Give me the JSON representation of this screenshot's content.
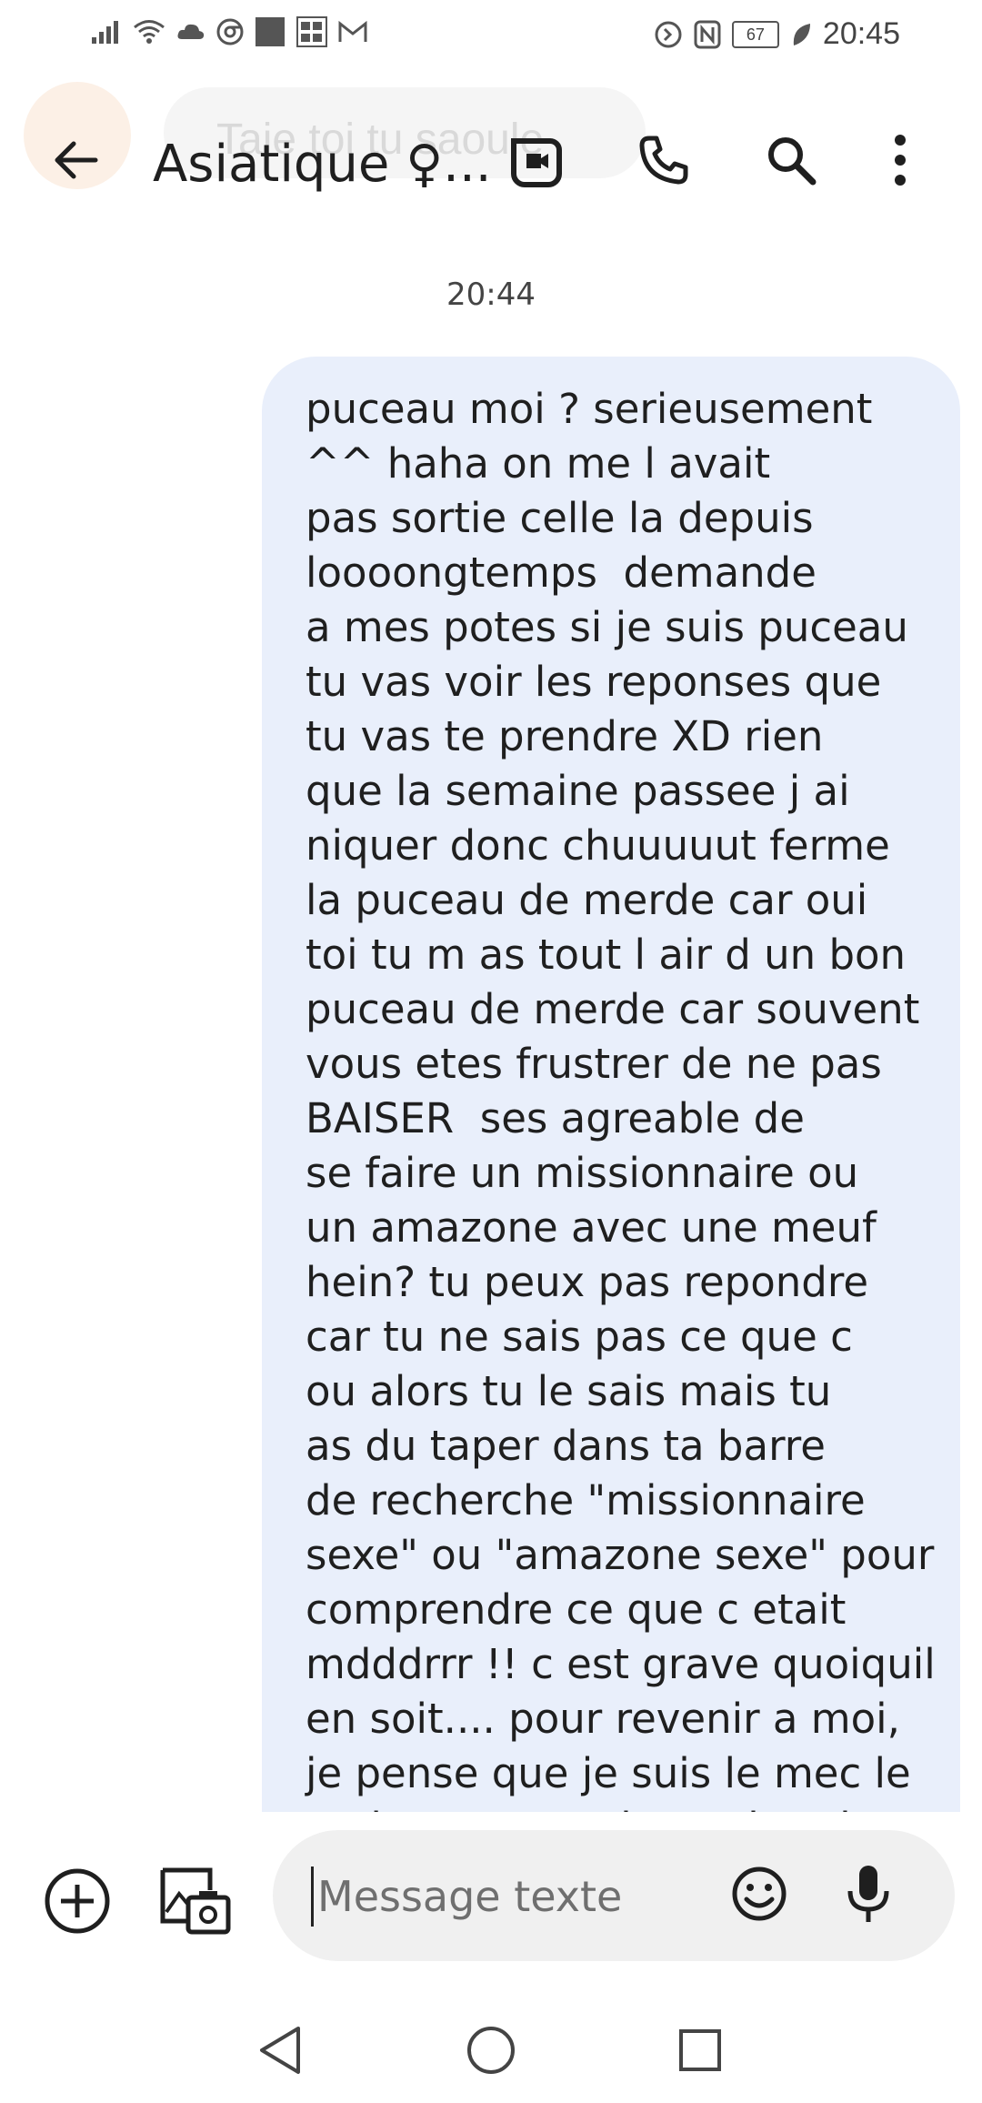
{
  "status_bar": {
    "time": "20:45",
    "battery": "67",
    "icons": [
      "signal-icon",
      "wifi-icon",
      "cloud-icon",
      "chrome-icon",
      "square-icon",
      "news-icon",
      "gmail-icon",
      "data-saver-icon",
      "nfc-icon",
      "battery-icon",
      "leaf-icon"
    ]
  },
  "ghost_notification": {
    "text": "Taie toi tu saoule"
  },
  "header": {
    "title": "Asiatique ♀...",
    "icons": [
      "back-arrow-icon",
      "video-call-icon",
      "phone-icon",
      "search-icon",
      "more-vert-icon"
    ]
  },
  "conversation": {
    "timestamp": "20:44",
    "message": "puceau moi ? serieusement\n^^ haha on me l avait\npas sortie celle la depuis\nloooongtemps ￼ demande\na mes potes si je suis puceau\ntu vas voir les reponses que\ntu vas te prendre XD rien\nque la semaine passee j ai\nniquer donc chuuuuut ferme\nla puceau de merde car oui\ntoi tu m as tout l air d un bon\npuceau de merde car souvent\nvous etes frustrer de ne pas\nBAISER ￼ ses agreable de\nse faire un missionnaire ou\nun amazone avec une meuf\nhein? tu peux pas repondre\ncar tu ne sais pas ce que c\nou alors tu le sais mais tu\nas du taper dans ta barre\nde recherche \"missionnaire\nsexe\" ou \"amazone sexe\" pour\ncomprendre ce que c etait\nmdddrrr !! c est grave quoiquil\nen soit.... pour revenir a moi,\nje pense que je suis le mec le\nmoins puceau de ma bande"
  },
  "composer": {
    "placeholder": "Message texte",
    "icons": [
      "add-circle-icon",
      "gallery-camera-icon",
      "emoji-icon",
      "mic-icon"
    ]
  },
  "nav": {
    "icons": [
      "nav-back-icon",
      "nav-home-icon",
      "nav-recents-icon"
    ]
  },
  "colors": {
    "bubble": "#e9effb",
    "input_bg": "#f0f0f0",
    "text": "#1f1f1f"
  }
}
